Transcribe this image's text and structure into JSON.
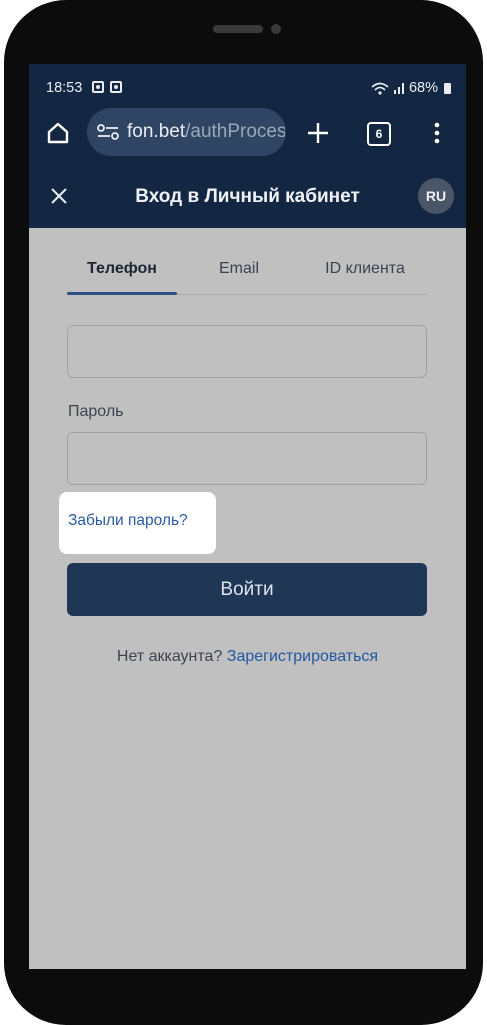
{
  "status_bar": {
    "time": "18:53",
    "battery": "68%"
  },
  "browser": {
    "url_domain": "fon.bet",
    "url_path": "/authProcess",
    "tab_count": "6"
  },
  "header": {
    "title": "Вход в Личный кабинет",
    "language": "RU"
  },
  "tabs": [
    {
      "label": "Телефон",
      "active": true
    },
    {
      "label": "Email",
      "active": false
    },
    {
      "label": "ID клиента",
      "active": false
    }
  ],
  "form": {
    "phone_value": "",
    "password_label": "Пароль",
    "password_value": "",
    "forgot_password": "Забыли пароль?",
    "login_button": "Войти"
  },
  "footer": {
    "no_account_text": "Нет аккаунта?",
    "register_link": "Зарегистрироваться"
  },
  "colors": {
    "topbar": "#142742",
    "primary_button": "#203655",
    "link": "#2a5aa5",
    "screen_overlay": "#c0c0c0"
  }
}
